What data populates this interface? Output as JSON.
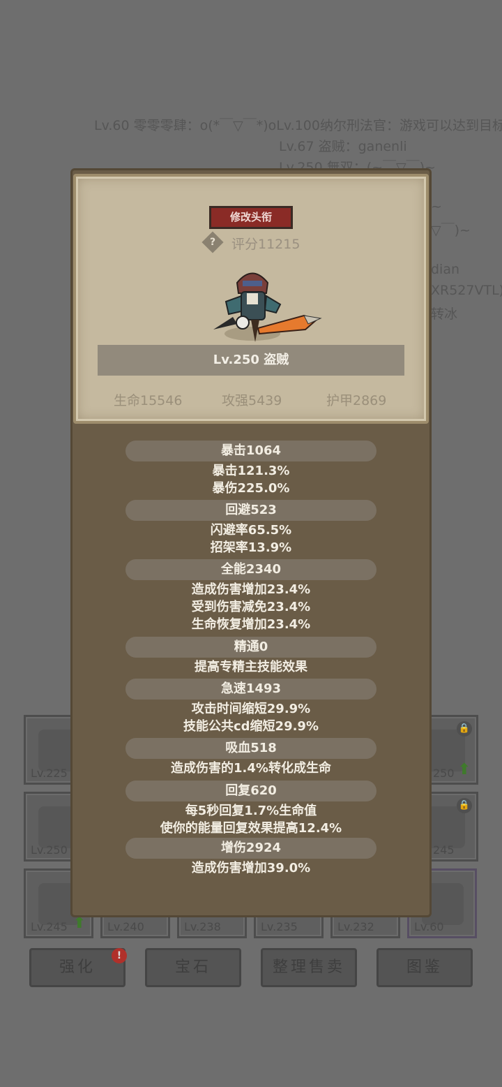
{
  "background_chat": [
    "Lv.60 零零零肆：o(*￣▽￣*)oLv.100纳尔刑法官：游戏可以达到目标吗?",
    "Lv.67 盗贼：ganenli",
    "Lv.250 無双：(~￣▽￣)~",
    "~",
    "▽￣)~",
    "dian",
    "XR527VTL) I",
    "转冰"
  ],
  "inventory_slots": [
    {
      "level": "Lv.225",
      "upgrade": false,
      "locked": false
    },
    {
      "level": "250",
      "upgrade": true,
      "locked": true
    },
    {
      "level": "Lv.250",
      "upgrade": false,
      "locked": false
    },
    {
      "level": "245",
      "upgrade": false,
      "locked": true
    },
    {
      "level": "Lv.245",
      "upgrade": true,
      "locked": false
    },
    {
      "level": "Lv.240",
      "upgrade": false,
      "locked": false
    },
    {
      "level": "Lv.238",
      "upgrade": false,
      "locked": false
    },
    {
      "level": "Lv.235",
      "upgrade": false,
      "locked": false
    },
    {
      "level": "Lv.232",
      "upgrade": false,
      "locked": false
    },
    {
      "level": "Lv.60",
      "upgrade": false,
      "locked": false
    }
  ],
  "bottom_buttons": {
    "enhance": "强化",
    "gem": "宝石",
    "sort_sell": "整理售卖",
    "codex": "图鉴",
    "enhance_badge": "!"
  },
  "profile": {
    "edit_title_button": "修改头衔",
    "help_icon": "?",
    "score": "评分11215",
    "name": "Lv.250 盗贼",
    "hp": "生命15546",
    "attack": "攻强5439",
    "armor": "护甲2869"
  },
  "stats": {
    "crit_header": "暴击1064",
    "crit_rate": "暴击121.3%",
    "crit_dmg": "暴伤225.0%",
    "dodge_header": "回避523",
    "dodge_rate": "闪避率65.5%",
    "parry_rate": "招架率13.9%",
    "versatility_header": "全能2340",
    "dmg_up": "造成伤害增加23.4%",
    "dmg_taken_down": "受到伤害减免23.4%",
    "heal_up": "生命恢复增加23.4%",
    "mastery_header": "精通0",
    "mastery_desc": "提高专精主技能效果",
    "haste_header": "急速1493",
    "atk_time": "攻击时间缩短29.9%",
    "skill_cd": "技能公共cd缩短29.9%",
    "leech_header": "吸血518",
    "leech_desc": "造成伤害的1.4%转化成生命",
    "regen_header": "回复620",
    "regen_desc1": "每5秒回复1.7%生命值",
    "regen_desc2": "使你的能量回复效果提高12.4%",
    "dmg_bonus_header": "增伤2924",
    "dmg_bonus_desc": "造成伤害增加39.0%"
  },
  "colors": {
    "panel_brown": "#6a5c47",
    "parchment": "#c5b99f",
    "title_button_red": "#8a2b26",
    "upgrade_green": "#3f7a2c"
  }
}
